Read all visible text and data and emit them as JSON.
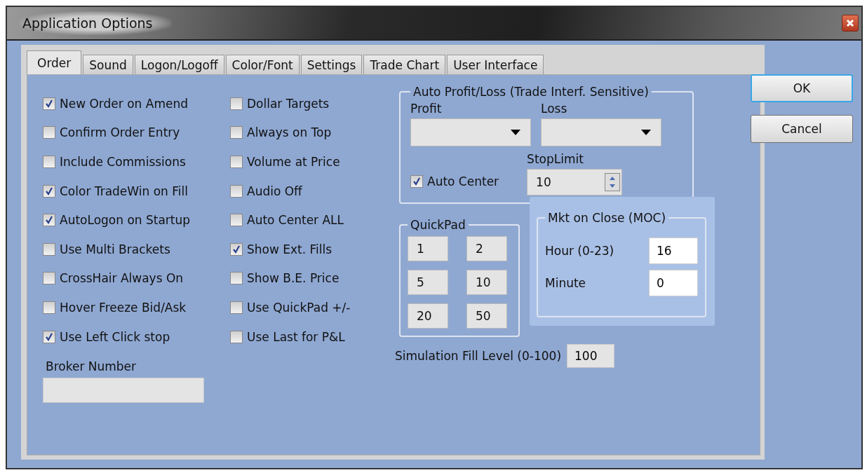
{
  "window": {
    "title": "Application Options"
  },
  "tabs": [
    {
      "label": "Order",
      "selected": true
    },
    {
      "label": "Sound",
      "selected": false
    },
    {
      "label": "Logon/Logoff",
      "selected": false
    },
    {
      "label": "Color/Font",
      "selected": false
    },
    {
      "label": "Settings",
      "selected": false
    },
    {
      "label": "Trade Chart",
      "selected": false
    },
    {
      "label": "User Interface",
      "selected": false
    }
  ],
  "option_columns": [
    {
      "items": [
        {
          "label": "New Order on Amend",
          "checked": true
        },
        {
          "label": "Confirm Order Entry",
          "checked": false
        },
        {
          "label": "Include Commissions",
          "checked": false
        },
        {
          "label": "Color TradeWin on Fill",
          "checked": true
        },
        {
          "label": "AutoLogon on Startup",
          "checked": true
        },
        {
          "label": "Use Multi Brackets",
          "checked": false
        },
        {
          "label": "CrossHair Always On",
          "checked": false
        },
        {
          "label": "Hover Freeze Bid/Ask",
          "checked": false
        },
        {
          "label": "Use Left Click stop",
          "checked": true
        }
      ]
    },
    {
      "items": [
        {
          "label": "Dollar Targets",
          "checked": false
        },
        {
          "label": "Always on Top",
          "checked": false
        },
        {
          "label": "Volume at Price",
          "checked": false
        },
        {
          "label": "Audio Off",
          "checked": false
        },
        {
          "label": "Auto Center ALL",
          "checked": false
        },
        {
          "label": "Show Ext. Fills",
          "checked": true
        },
        {
          "label": "Show B.E. Price",
          "checked": false
        },
        {
          "label": "Use QuickPad +/-",
          "checked": false
        },
        {
          "label": "Use Last for P&L",
          "checked": false
        }
      ]
    }
  ],
  "broker_number": {
    "label": "Broker Number"
  },
  "auto_profit_loss": {
    "title": "Auto Profit/Loss (Trade Interf. Sensitive)",
    "profit_label": "Profit",
    "loss_label": "Loss",
    "auto_center": {
      "label": "Auto Center",
      "checked": true
    },
    "stop_limit": {
      "label": "StopLimit",
      "value": "10"
    }
  },
  "quickpad": {
    "title": "QuickPad",
    "buttons": [
      "1",
      "2",
      "5",
      "10",
      "20",
      "50"
    ]
  },
  "moc": {
    "title": "Mkt on Close (MOC)",
    "hour": {
      "label": "Hour (0-23)",
      "value": "16"
    },
    "minute": {
      "label": "Minute",
      "value": "0"
    }
  },
  "simulation_fill": {
    "label": "Simulation Fill Level (0-100)",
    "value": "100"
  },
  "buttons": [
    {
      "label": "OK",
      "focused": true
    },
    {
      "label": "Cancel",
      "focused": false
    }
  ]
}
